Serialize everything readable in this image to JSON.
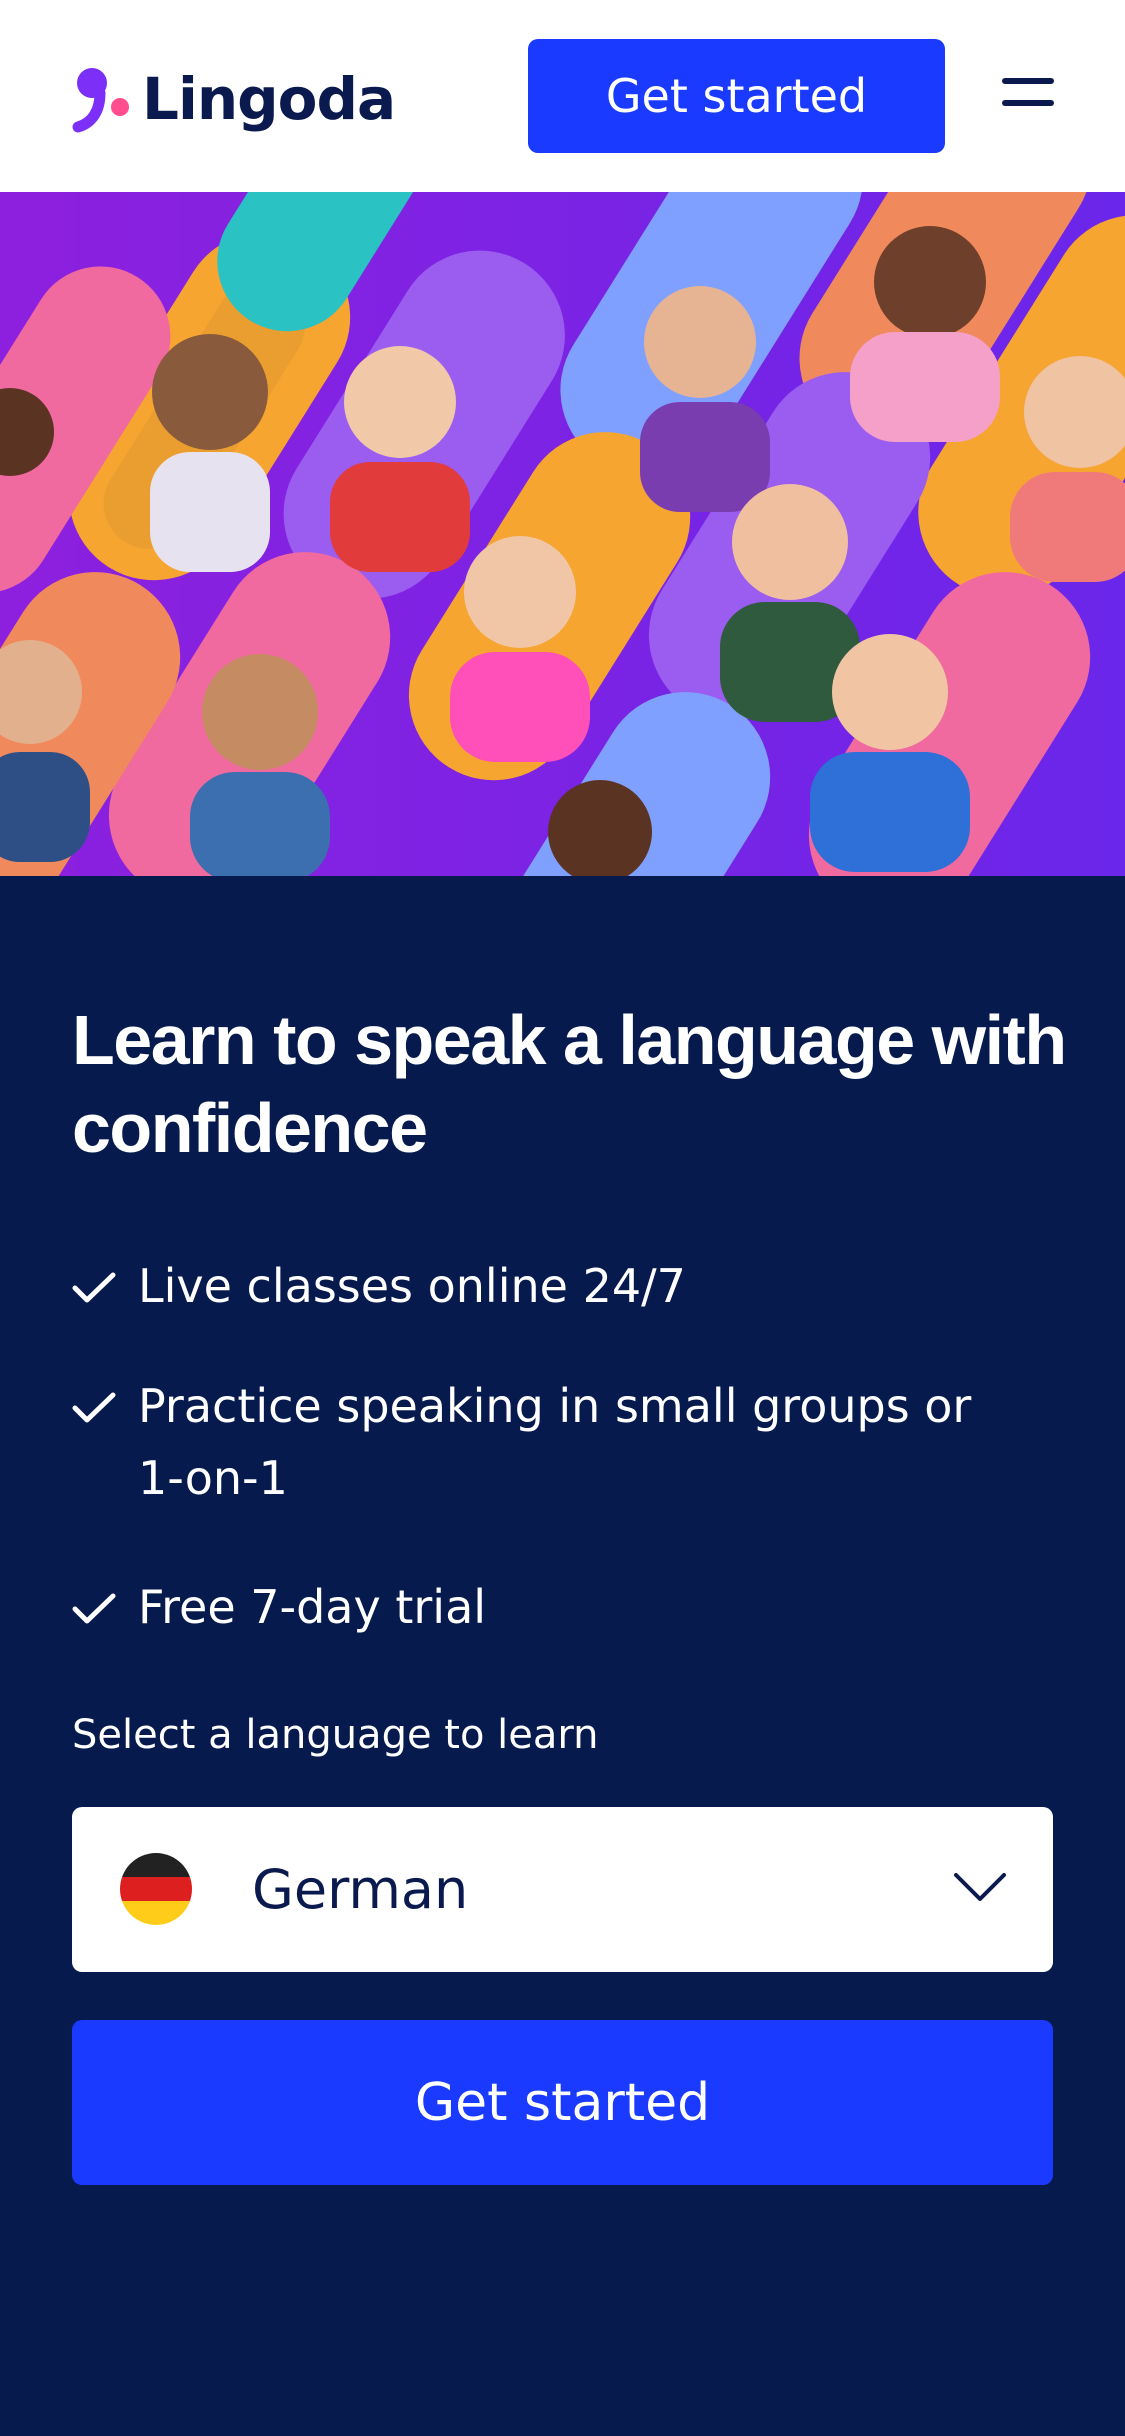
{
  "header": {
    "logo_text": "Lingoda",
    "cta_label": "Get started",
    "menu_icon": "hamburger-menu-icon"
  },
  "hero": {
    "image": "collage-of-smiling-language-learners",
    "colors": {
      "background": "#7a20e4",
      "orange": "#f6a531",
      "pink": "#f06aa0",
      "blue": "#7fa0ff",
      "violet": "#9b5cf0"
    }
  },
  "main": {
    "headline": "Learn to speak a language with confidence",
    "features": [
      {
        "icon": "check-icon",
        "text": "Live classes online 24/7"
      },
      {
        "icon": "check-icon",
        "text": "Practice speaking in small groups or 1-on-1"
      },
      {
        "icon": "check-icon",
        "text": "Free 7-day trial"
      }
    ],
    "select_label": "Select a language to learn",
    "language": {
      "value": "German",
      "flag_icon": "germany-flag-icon",
      "chevron_icon": "chevron-down-icon"
    },
    "cta_label": "Get started"
  },
  "colors": {
    "brand_blue": "#1a3bff",
    "navy": "#061a4d",
    "logo_text": "#0b1a4e",
    "logo_dot_purple": "#7b2ff7",
    "logo_dot_pink": "#ff4d8d"
  }
}
